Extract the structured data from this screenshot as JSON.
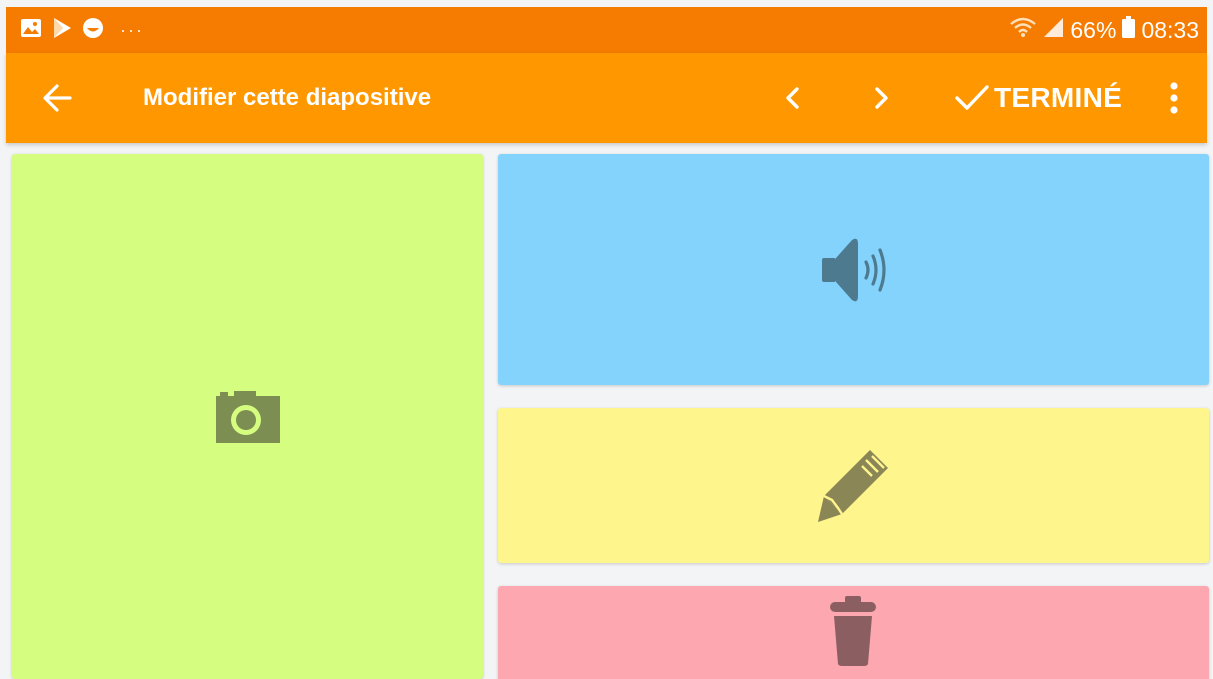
{
  "status_bar": {
    "icons_left": [
      "gallery-icon",
      "play-store-icon",
      "smiley-icon"
    ],
    "overflow": "···",
    "icons_right": [
      "wifi-icon",
      "signal-icon"
    ],
    "battery_percent": "66%",
    "time": "08:33"
  },
  "app_bar": {
    "title": "Modifier cette diapositive",
    "done_label": "TERMINÉ",
    "icons": [
      "back-arrow-icon",
      "chevron-left-icon",
      "chevron-right-icon",
      "check-icon",
      "more-vert-icon"
    ]
  },
  "tiles": [
    {
      "name": "image-tile",
      "icon": "camera-icon",
      "color": "#d5fd7f"
    },
    {
      "name": "audio-tile",
      "icon": "speaker-icon",
      "color": "#83d3fd"
    },
    {
      "name": "text-tile",
      "icon": "pencil-icon",
      "color": "#fef58c"
    },
    {
      "name": "delete-tile",
      "icon": "trash-icon",
      "color": "#fda8b1"
    }
  ],
  "colors": {
    "status_bar": "#f57c00",
    "app_bar": "#ff9800",
    "background": "#f3f4f6"
  }
}
